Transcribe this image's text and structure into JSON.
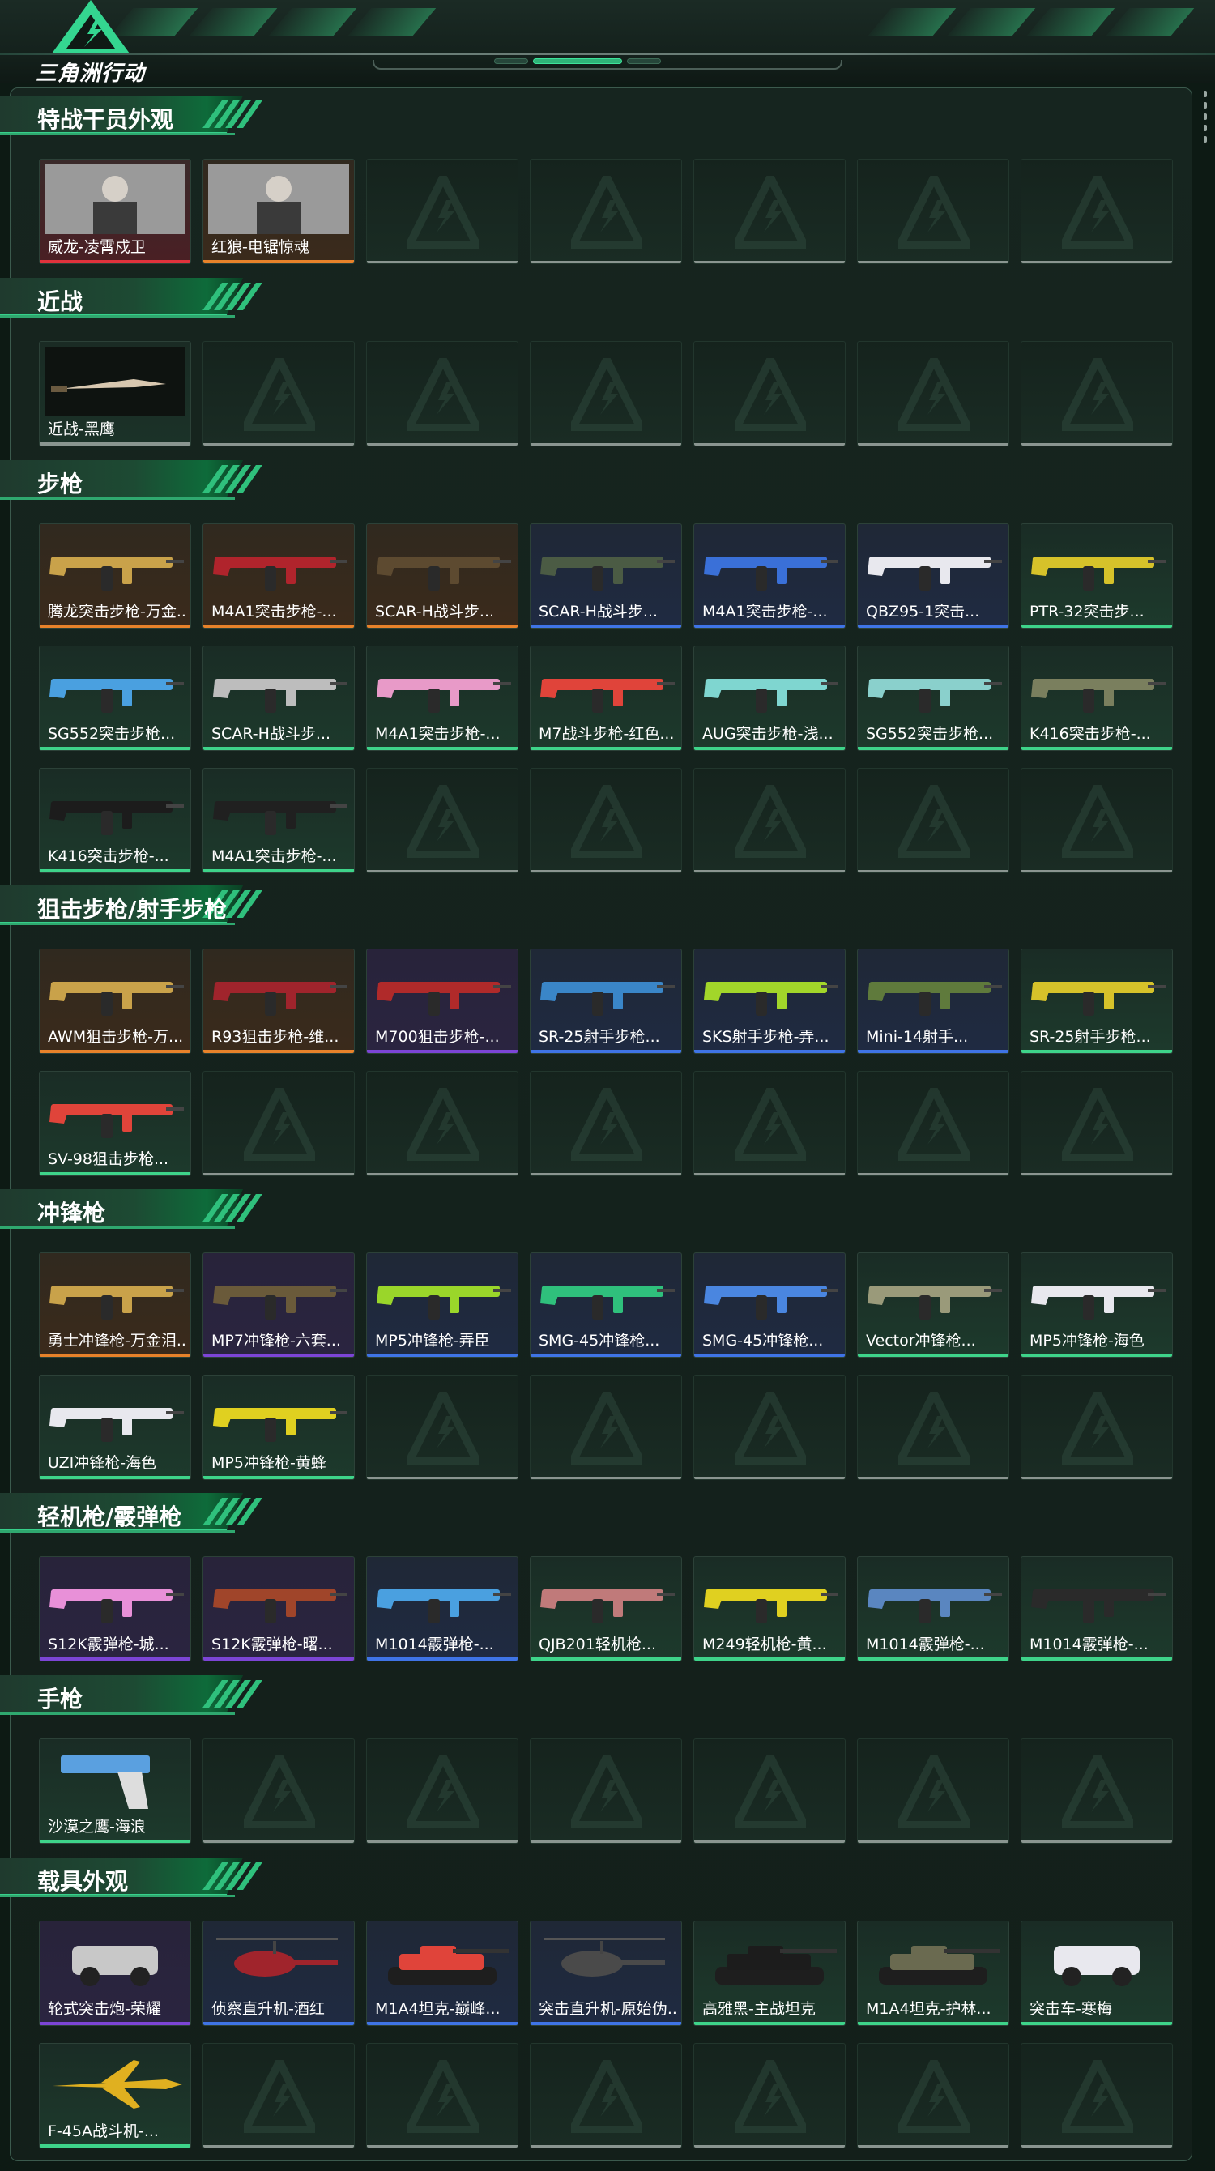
{
  "app": {
    "logo_text": "三角洲行动"
  },
  "colors": {
    "accent": "#2fc07c",
    "rarity": {
      "red": "#e0323c",
      "orange": "#e8822a",
      "purple": "#7c45d6",
      "blue": "#3f74e6",
      "green": "#3ed48a",
      "empty": "#8a9590"
    }
  },
  "sections": [
    {
      "title": "特战干员外观",
      "items": [
        {
          "label": "威龙-凌霄戍卫",
          "rarity": "red",
          "icon": "operator-portrait"
        },
        {
          "label": "红狼-电锯惊魂",
          "rarity": "orange",
          "icon": "operator-portrait"
        }
      ]
    },
    {
      "title": "近战",
      "items": [
        {
          "label": "近战-黑鹰",
          "rarity": "none",
          "icon": "knife-icon"
        }
      ]
    },
    {
      "title": "步枪",
      "items": [
        {
          "label": "腾龙突击步枪-万金...",
          "rarity": "orange",
          "icon": "rifle-icon",
          "skin": "#c9a24a"
        },
        {
          "label": "M4A1突击步枪-...",
          "rarity": "orange",
          "icon": "rifle-icon",
          "skin": "#b0242c"
        },
        {
          "label": "SCAR-H战斗步...",
          "rarity": "orange",
          "icon": "rifle-icon",
          "skin": "#5d4a30"
        },
        {
          "label": "SCAR-H战斗步...",
          "rarity": "blue",
          "icon": "rifle-icon",
          "skin": "#4b5b44"
        },
        {
          "label": "M4A1突击步枪-...",
          "rarity": "blue",
          "icon": "rifle-icon",
          "skin": "#3a70d8"
        },
        {
          "label": "QBZ95-1突击...",
          "rarity": "blue",
          "icon": "rifle-icon",
          "skin": "#e8e8ee"
        },
        {
          "label": "PTR-32突击步...",
          "rarity": "green",
          "icon": "rifle-icon",
          "skin": "#d6c22a"
        },
        {
          "label": "SG552突击步枪...",
          "rarity": "green",
          "icon": "rifle-icon",
          "skin": "#4aa0e0"
        },
        {
          "label": "SCAR-H战斗步...",
          "rarity": "green",
          "icon": "rifle-icon",
          "skin": "#bdbdbd"
        },
        {
          "label": "M4A1突击步枪-...",
          "rarity": "green",
          "icon": "rifle-icon",
          "skin": "#e89ac8"
        },
        {
          "label": "M7战斗步枪-红色...",
          "rarity": "green",
          "icon": "rifle-icon",
          "skin": "#e0443a"
        },
        {
          "label": "AUG突击步枪-浅...",
          "rarity": "green",
          "icon": "rifle-icon",
          "skin": "#7fd6d0"
        },
        {
          "label": "SG552突击步枪...",
          "rarity": "green",
          "icon": "rifle-icon",
          "skin": "#8ad0cc"
        },
        {
          "label": "K416突击步枪-...",
          "rarity": "green",
          "icon": "rifle-icon",
          "skin": "#7a7f5e"
        },
        {
          "label": "K416突击步枪-...",
          "rarity": "green",
          "icon": "rifle-icon",
          "skin": "#1c1c1c"
        },
        {
          "label": "M4A1突击步枪-...",
          "rarity": "green",
          "icon": "rifle-icon",
          "skin": "#202020"
        }
      ]
    },
    {
      "title": "狙击步枪/射手步枪",
      "items": [
        {
          "label": "AWM狙击步枪-万...",
          "rarity": "orange",
          "icon": "sniper-icon",
          "skin": "#c9a24a"
        },
        {
          "label": "R93狙击步枪-维...",
          "rarity": "orange",
          "icon": "sniper-icon",
          "skin": "#a0242c"
        },
        {
          "label": "M700狙击步枪-...",
          "rarity": "purple",
          "icon": "sniper-icon",
          "skin": "#b02a2a"
        },
        {
          "label": "SR-25射手步枪...",
          "rarity": "blue",
          "icon": "sniper-icon",
          "skin": "#3a86c8"
        },
        {
          "label": "SKS射手步枪-弄...",
          "rarity": "blue",
          "icon": "sniper-icon",
          "skin": "#a2d62a"
        },
        {
          "label": "Mini-14射手...",
          "rarity": "blue",
          "icon": "sniper-icon",
          "skin": "#5f7a3c"
        },
        {
          "label": "SR-25射手步枪...",
          "rarity": "green",
          "icon": "sniper-icon",
          "skin": "#d6c22a"
        },
        {
          "label": "SV-98狙击步枪...",
          "rarity": "green",
          "icon": "sniper-icon",
          "skin": "#e0443a"
        }
      ]
    },
    {
      "title": "冲锋枪",
      "items": [
        {
          "label": "勇士冲锋枪-万金泪...",
          "rarity": "orange",
          "icon": "smg-icon",
          "skin": "#c9a24a"
        },
        {
          "label": "MP7冲锋枪-六套...",
          "rarity": "purple",
          "icon": "smg-icon",
          "skin": "#6a5a3a"
        },
        {
          "label": "MP5冲锋枪-弄臣",
          "rarity": "blue",
          "icon": "smg-icon",
          "skin": "#9ad62a"
        },
        {
          "label": "SMG-45冲锋枪...",
          "rarity": "blue",
          "icon": "smg-icon",
          "skin": "#2fc07c"
        },
        {
          "label": "SMG-45冲锋枪...",
          "rarity": "blue",
          "icon": "smg-icon",
          "skin": "#4a86e0"
        },
        {
          "label": "Vector冲锋枪...",
          "rarity": "green",
          "icon": "smg-icon",
          "skin": "#9a9a7a"
        },
        {
          "label": "MP5冲锋枪-海色",
          "rarity": "green",
          "icon": "smg-icon",
          "skin": "#e8e8ee"
        },
        {
          "label": "UZI冲锋枪-海色",
          "rarity": "green",
          "icon": "smg-icon",
          "skin": "#e8e8ee"
        },
        {
          "label": "MP5冲锋枪-黄蜂",
          "rarity": "green",
          "icon": "smg-icon",
          "skin": "#e0d020"
        }
      ]
    },
    {
      "title": "轻机枪/霰弹枪",
      "items": [
        {
          "label": "S12K霰弹枪-城...",
          "rarity": "purple",
          "icon": "shotgun-icon",
          "skin": "#e890d8"
        },
        {
          "label": "S12K霰弹枪-曙...",
          "rarity": "purple",
          "icon": "shotgun-icon",
          "skin": "#a0452a"
        },
        {
          "label": "M1014霰弹枪-...",
          "rarity": "blue",
          "icon": "shotgun-icon",
          "skin": "#4aa0e0"
        },
        {
          "label": "QJB201轻机枪...",
          "rarity": "green",
          "icon": "lmg-icon",
          "skin": "#c07a7a"
        },
        {
          "label": "M249轻机枪-黄...",
          "rarity": "green",
          "icon": "lmg-icon",
          "skin": "#e0d020"
        },
        {
          "label": "M1014霰弹枪-...",
          "rarity": "green",
          "icon": "shotgun-icon",
          "skin": "#5a86c0"
        },
        {
          "label": "M1014霰弹枪-...",
          "rarity": "green",
          "icon": "shotgun-icon",
          "skin": "#2a2a2a"
        }
      ]
    },
    {
      "title": "手枪",
      "items": [
        {
          "label": "沙漠之鹰-海浪",
          "rarity": "green",
          "icon": "pistol-icon",
          "skin": "#5aa0e0"
        }
      ]
    },
    {
      "title": "载具外观",
      "items": [
        {
          "label": "轮式突击炮-荣耀",
          "rarity": "purple",
          "icon": "vehicle-icon",
          "skin": "#c8c8c8"
        },
        {
          "label": "侦察直升机-酒红",
          "rarity": "blue",
          "icon": "helicopter-icon",
          "skin": "#a0242c"
        },
        {
          "label": "M1A4坦克-巅峰...",
          "rarity": "blue",
          "icon": "tank-icon",
          "skin": "#e0443a"
        },
        {
          "label": "突击直升机-原始伪...",
          "rarity": "blue",
          "icon": "helicopter-icon",
          "skin": "#4a4a4a"
        },
        {
          "label": "高雅黑-主战坦克",
          "rarity": "green",
          "icon": "tank-icon",
          "skin": "#1c1c1c"
        },
        {
          "label": "M1A4坦克-护林...",
          "rarity": "green",
          "icon": "tank-icon",
          "skin": "#6a6a50"
        },
        {
          "label": "突击车-寒梅",
          "rarity": "green",
          "icon": "vehicle-icon",
          "skin": "#e8e8ee"
        },
        {
          "label": "F-45A战斗机-...",
          "rarity": "green",
          "icon": "jet-icon",
          "skin": "#e0b020"
        }
      ]
    }
  ]
}
